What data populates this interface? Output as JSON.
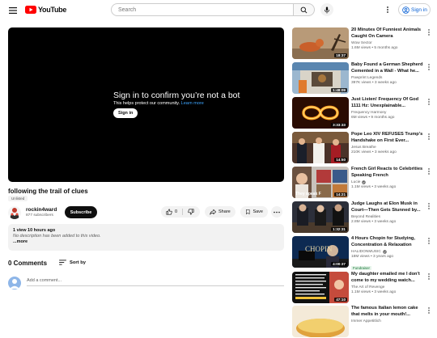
{
  "header": {
    "logo_text": "YouTube",
    "search_placeholder": "Search",
    "signin_label": "Sign in"
  },
  "player": {
    "title": "Sign in to confirm you’re not a bot",
    "subtitle": "This helps protect our community.",
    "learn_more": "Learn more",
    "button": "Sign in"
  },
  "video": {
    "title": "following the trail of clues",
    "badge": "Unlisted",
    "channel": "rockin4ward",
    "subscribers": "877 subscribers",
    "subscribe_label": "Subscribe",
    "likes": "0",
    "share_label": "Share",
    "save_label": "Save"
  },
  "description": {
    "stats": "1 view  10 hours ago",
    "text": "No description has been added to this video.",
    "more": "...more"
  },
  "comments": {
    "count": "0 Comments",
    "sort_label": "Sort by",
    "placeholder": "Add a comment..."
  },
  "recommendations": [
    {
      "title": "20 Minutes Of Funniest Animals Caught On Camera",
      "channel": "Wow Sector",
      "meta": "1.6M views • 5 months ago",
      "duration": "18:37",
      "verified": false,
      "fundraiser": false
    },
    {
      "title": "Baby Found a German Shepherd Cemented in a Wall - What he...",
      "channel": "Pawprint Legends",
      "meta": "397K views • 3 weeks ago",
      "duration": "1:48:09",
      "verified": false,
      "fundraiser": false
    },
    {
      "title": "Just Listen! Frequency Of God 1111 Hz: Unexplainable...",
      "channel": "Frequency Harmony",
      "meta": "6M views • 9 months ago",
      "duration": "3:33:33",
      "verified": false,
      "fundraiser": false
    },
    {
      "title": "Pope Leo XIV REFUSES Trump's Handshake on First Ever...",
      "channel": "Jesus Breathe",
      "meta": "210K views • 3 weeks ago",
      "duration": "14:50",
      "verified": false,
      "fundraiser": false
    },
    {
      "title": "French Girl Reacts to Celebrities Speaking French",
      "channel": "Lucie",
      "meta": "1.1M views • 3 weeks ago",
      "duration": "14:21",
      "verified": true,
      "fundraiser": false,
      "thumb_caption": "They speak F"
    },
    {
      "title": "Judge Laughs at Elon Musk in Court—Then Gets Stunned by...",
      "channel": "Beyond Realities",
      "meta": "2.8M views • 3 weeks ago",
      "duration": "1:32:31",
      "verified": false,
      "fundraiser": false
    },
    {
      "title": "4 Hours Chopin for Studying, Concentration & Relaxation",
      "channel": "HALIDONMUSIC",
      "meta": "18M views • 3 years ago",
      "duration": "4:00:37",
      "verified": true,
      "fundraiser": true,
      "fundraiser_label": "Fundraiser",
      "thumb_caption": "CHOPIN"
    },
    {
      "title": "My daughter emailed me I don't come to my wedding watch...",
      "channel": "The Art of Revenge",
      "meta": "1.1M views • 3 weeks ago",
      "duration": "47:10",
      "verified": false,
      "fundraiser": false
    },
    {
      "title": "The famous Italian lemon cake that melts in your mouth!...",
      "channel": "Immer Appetitlich",
      "meta": "",
      "duration": "",
      "verified": false,
      "fundraiser": false
    }
  ],
  "colors": {
    "accent": "#ff0000",
    "link": "#065fd4",
    "subscribe_bg": "#0f0f0f",
    "fund_green": "#137333"
  }
}
